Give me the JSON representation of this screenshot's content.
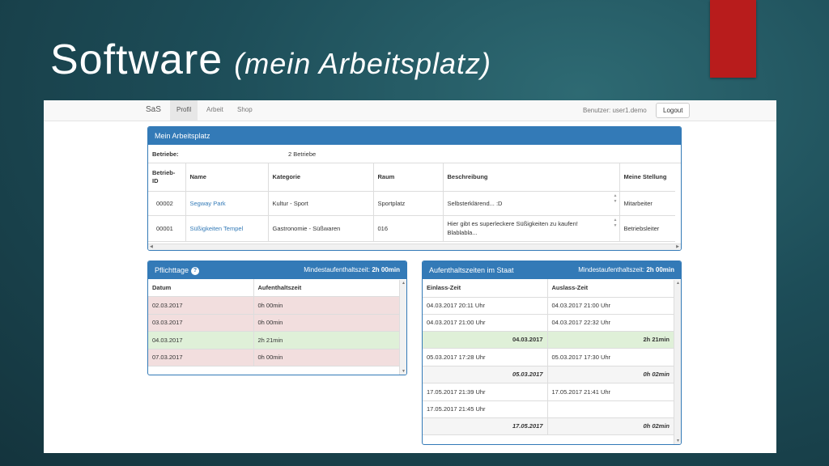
{
  "slide": {
    "title": "Software",
    "subtitle": "(mein Arbeitsplatz)"
  },
  "colors": {
    "accent": "#337ab7",
    "title_bar": "#b81c1c",
    "row_red": "#f2dede",
    "row_green": "#dff0d8"
  },
  "navbar": {
    "brand": "SaS",
    "items": [
      "Profil",
      "Arbeit",
      "Shop"
    ],
    "user": "Benutzer: user1.demo",
    "logout": "Logout"
  },
  "workplace": {
    "title": "Mein Arbeitsplatz",
    "summary_label": "Betriebe:",
    "summary_value": "2 Betriebe",
    "columns": [
      "Betrieb-ID",
      "Name",
      "Kategorie",
      "Raum",
      "Beschreibung",
      "Meine Stellung"
    ],
    "col_betrieb_1": "Betrieb-",
    "col_betrieb_2": "ID",
    "rows": [
      {
        "id": "00002",
        "name": "Segway Park",
        "kategorie": "Kultur - Sport",
        "raum": "Sportplatz",
        "beschreibung_1": "Selbsterklärend... :D",
        "beschreibung_2": "",
        "stellung": "Mitarbeiter"
      },
      {
        "id": "00001",
        "name": "Süßigkeiten Tempel",
        "kategorie": "Gastronomie - Süßwaren",
        "raum": "016",
        "beschreibung_1": "Hier gibt es superleckere Süßigkeiten zu kaufen!",
        "beschreibung_2": "Blablabla...",
        "stellung": "Betriebsleiter"
      }
    ]
  },
  "pflicht": {
    "title": "Pflichttage",
    "min_label": "Mindestaufenthaltszeit:",
    "min_value": "2h 00min",
    "columns": [
      "Datum",
      "Aufenthaltszeit"
    ],
    "rows": [
      {
        "datum": "02.03.2017",
        "zeit": "0h 00min",
        "status": "red"
      },
      {
        "datum": "03.03.2017",
        "zeit": "0h 00min",
        "status": "red"
      },
      {
        "datum": "04.03.2017",
        "zeit": "2h 21min",
        "status": "green"
      },
      {
        "datum": "07.03.2017",
        "zeit": "0h 00min",
        "status": "red"
      }
    ]
  },
  "aufenthalt": {
    "title": "Aufenthaltszeiten im Staat",
    "min_label": "Mindestaufenthaltszeit:",
    "min_value": "2h 00min",
    "columns": [
      "Einlass-Zeit",
      "Auslass-Zeit"
    ],
    "rows": [
      {
        "a": "04.03.2017 20:11 Uhr",
        "b": "04.03.2017 21:00 Uhr",
        "type": "normal"
      },
      {
        "a": "04.03.2017 21:00 Uhr",
        "b": "04.03.2017 22:32 Uhr",
        "type": "normal"
      },
      {
        "a": "04.03.2017",
        "b": "2h 21min",
        "type": "green"
      },
      {
        "a": "05.03.2017 17:28 Uhr",
        "b": "05.03.2017 17:30 Uhr",
        "type": "normal"
      },
      {
        "a": "05.03.2017",
        "b": "0h 02min",
        "type": "sum"
      },
      {
        "a": "17.05.2017 21:39 Uhr",
        "b": "17.05.2017 21:41 Uhr",
        "type": "normal"
      },
      {
        "a": "17.05.2017 21:45 Uhr",
        "b": "",
        "type": "normal"
      },
      {
        "a": "17.05.2017",
        "b": "0h 02min",
        "type": "sum"
      }
    ]
  }
}
